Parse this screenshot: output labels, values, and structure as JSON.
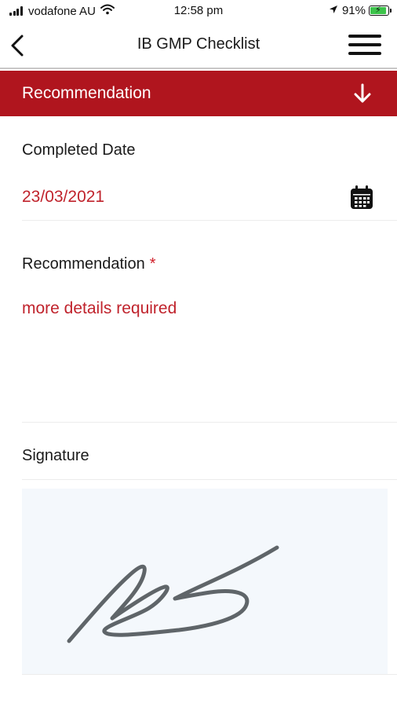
{
  "status_bar": {
    "carrier": "vodafone AU",
    "time": "12:58 pm",
    "battery": "91%",
    "battery_level": 0.91,
    "icons": [
      "signal-icon",
      "wifi-icon",
      "location-arrow-icon",
      "battery-charging-icon"
    ]
  },
  "nav": {
    "title": "IB GMP Checklist",
    "back_icon": "chevron-left-icon",
    "menu_icon": "hamburger-menu-icon"
  },
  "section": {
    "title": "Recommendation",
    "icon": "arrow-down-icon",
    "color": "#b0151e"
  },
  "fields": {
    "completed_date": {
      "label": "Completed Date",
      "value": "23/03/2021",
      "icon": "calendar-icon"
    },
    "recommendation": {
      "label": "Recommendation",
      "required_mark": "*",
      "value": "more details required"
    },
    "signature": {
      "label": "Signature"
    }
  },
  "colors": {
    "accent": "#b0151e",
    "value_text": "#c0232c",
    "signature_bg": "#f4f8fc",
    "signature_ink": "#5f6569"
  }
}
